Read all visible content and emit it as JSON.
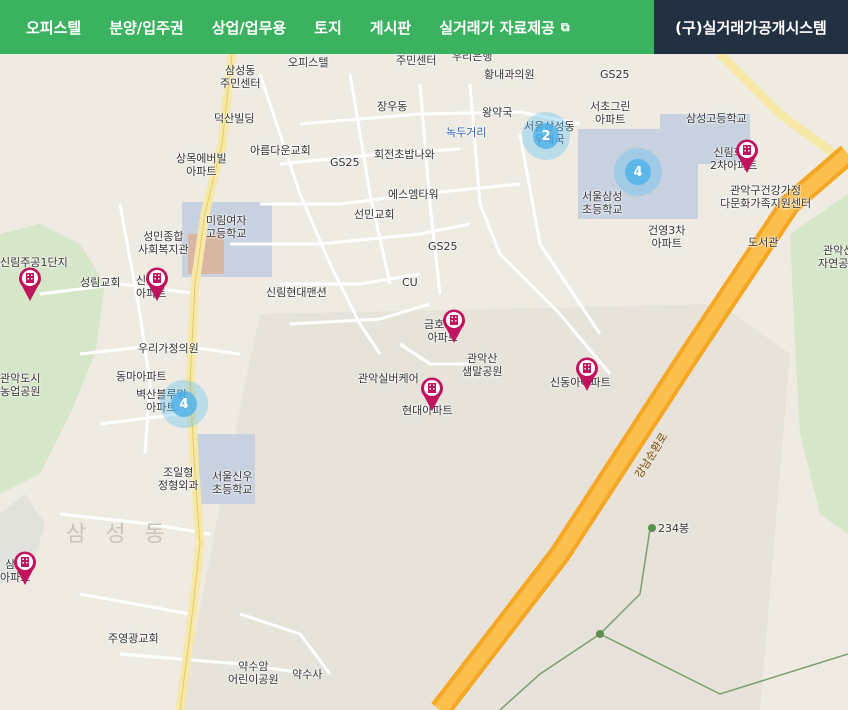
{
  "nav": {
    "items": [
      "오피스텔",
      "분양/입주권",
      "상업/업무용",
      "토지",
      "게시판",
      "실거래가 자료제공"
    ],
    "external_icon": "external-link-icon",
    "dark_item": "(구)실거래가공개시스템"
  },
  "colors": {
    "nav_bg": "#3bb260",
    "nav_dark": "#233042",
    "pin": "#c0155e",
    "cluster": "#46afeb"
  },
  "map": {
    "district": "삼 성 동",
    "road": "강남순환로",
    "clusters": [
      "2",
      "4",
      "4"
    ],
    "labels": {
      "samsungdong_center": "삼성동\n주민센터",
      "officetel": "오피스텔",
      "jumin_center": "주민센터",
      "woori_bank": "우리은행",
      "hwangnae": "황내과의원",
      "gs25_a": "GS25",
      "jangwoodong": "장우동",
      "wangyakguk": "왕약국",
      "seocho_green": "서초그린\n아파트",
      "samsung_hs": "삼성고등학교",
      "noktu": "녹두거리",
      "seoul_samsung_dong": "서울삼성동\n우체국",
      "sinlim_hwaun": "신림화운\n2차아파트",
      "deoksan": "덕산빌딩",
      "areum_church": "아름다운교회",
      "gs25_b": "GS25",
      "hoejeon": "회전초밥나와",
      "sangmok": "상목에버빌\n아파트",
      "sangmok2": "관악구건강가정\n다문화가족지원센터",
      "seoul_samsung_es": "서울삼성\n초등학교",
      "geonyoung": "건영3차\n아파트",
      "library": "도서관",
      "gwanak_nature": "관악산\n자연공원",
      "esem": "에스엠타워",
      "seonmin": "선민교회",
      "mirim_girls": "미림여자\n고등학교",
      "seongmin": "성민종합\n사회복지관",
      "gs25_c": "GS25",
      "cu": "CU",
      "sinlim_jugong": "신림주공1단지",
      "seongnim_church": "성림교회",
      "sinlim_apt": "신림동\n아파트",
      "sinlim_hyundai": "신림현대맨션",
      "geumho": "금호1차\n아파트",
      "woori_clinic": "우리가정의원",
      "gwanak_park": "관악산\n샘말공원",
      "sindong_apt": "신동아아파트",
      "gwanak_care": "관악실버케어",
      "hyundai_apt": "현대아파트",
      "dongma": "동마아파트",
      "byeoksan": "벽산블루밍\n아파트",
      "gwanak_city": "관악도시\n농업공원",
      "joil": "조일형\n정형외과",
      "seoul_sinwoo": "서울신우\n초등학교",
      "peak": "234봉",
      "joyeong_church": "주영광교회",
      "yaksuam": "약수암\n어린이공원",
      "yaksusa": "약수사",
      "left_apt": "삼성\n아파트"
    }
  }
}
